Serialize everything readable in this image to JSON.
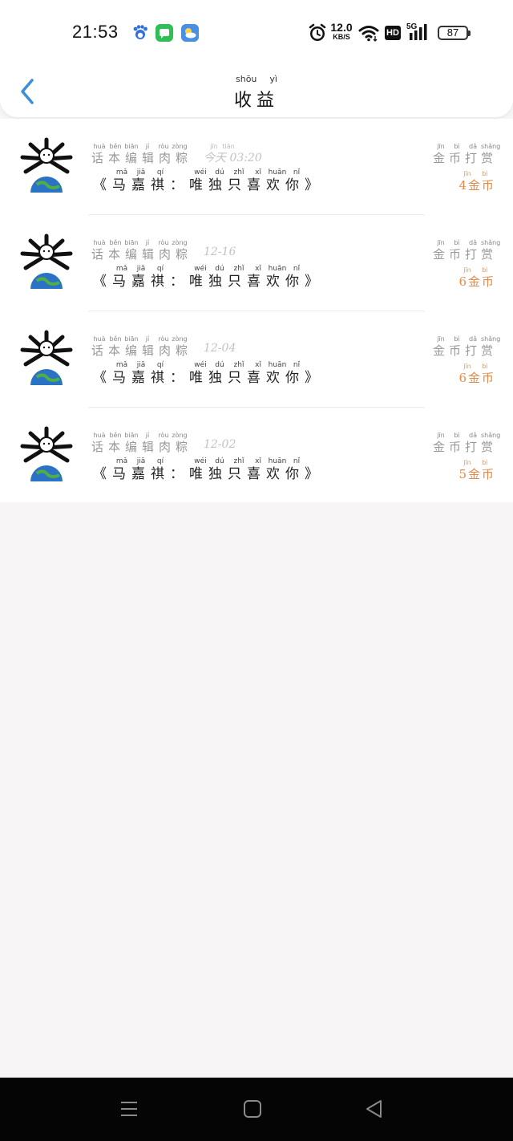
{
  "status_bar": {
    "time": "21:53",
    "net_speed_value": "12.0",
    "net_speed_unit": "KB/S",
    "hd_label": "HD",
    "network_label": "5G",
    "battery": "87"
  },
  "header": {
    "title": "收益",
    "title_pinyin": [
      "shōu",
      "yì"
    ]
  },
  "source_pinyin": [
    "huà",
    "běn",
    "biān",
    "jí",
    "ròu",
    "zòng"
  ],
  "title_pinyin": [
    "mǎ",
    "jiā",
    "qí",
    "wéi",
    "dú",
    "zhǐ",
    "xǐ",
    "huān",
    "nǐ"
  ],
  "tip_pinyin": [
    "jīn",
    "bì",
    "dǎ",
    "shǎng"
  ],
  "coin_pinyin": [
    "jīn",
    "bì"
  ],
  "today_pinyin": [
    "jīn",
    "tiān"
  ],
  "records": [
    {
      "source": "话本编辑肉粽",
      "date": "今天 03:20",
      "book": "《马嘉祺：唯独只喜欢你》",
      "tip_label": "金币打赏",
      "amount": "4金币"
    },
    {
      "source": "话本编辑肉粽",
      "date": "12-16",
      "book": "《马嘉祺：唯独只喜欢你》",
      "tip_label": "金币打赏",
      "amount": "6金币"
    },
    {
      "source": "话本编辑肉粽",
      "date": "12-04",
      "book": "《马嘉祺：唯独只喜欢你》",
      "tip_label": "金币打赏",
      "amount": "6金币"
    },
    {
      "source": "话本编辑肉粽",
      "date": "12-02",
      "book": "《马嘉祺：唯独只喜欢你》",
      "tip_label": "金币打赏",
      "amount": "5金币"
    }
  ],
  "colors": {
    "accent_blue": "#3a8fd8",
    "coin_orange": "#e38a47"
  }
}
